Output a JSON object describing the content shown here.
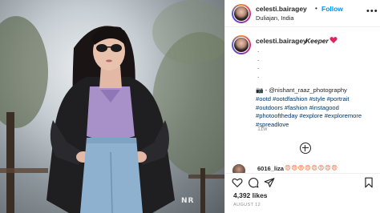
{
  "post": {
    "username": "celesti.bairagey",
    "dot": "•",
    "follow_label": "Follow",
    "location": "Duliajan, India",
    "more_label": "•••",
    "watermark": "NR",
    "caption": {
      "username": "celesti.bairagey",
      "text": "Keeper",
      "heart_color": "#e0245e",
      "dots": [
        ".",
        ".",
        ".",
        "."
      ],
      "lines": [
        "📷 - @nishant_raaz_photography",
        "#ootd #ootdfashion #style #portrait",
        "#outdoors #fashion #instagood",
        "#photooftheday #explore #exploremore",
        "#spreadlove"
      ],
      "time": "11w"
    },
    "comment": {
      "username": "6016_liza",
      "emoji": "😍😍😍😍😍😍😍😍"
    },
    "actions": [
      "heart-icon",
      "comment-icon",
      "share-icon",
      "save-icon"
    ],
    "likes": "4,392 likes",
    "date": "AUGUST 12"
  },
  "colors": {
    "link": "#00376b",
    "follow": "#0095f6",
    "muted": "#8e8e8e",
    "text": "#262626"
  }
}
